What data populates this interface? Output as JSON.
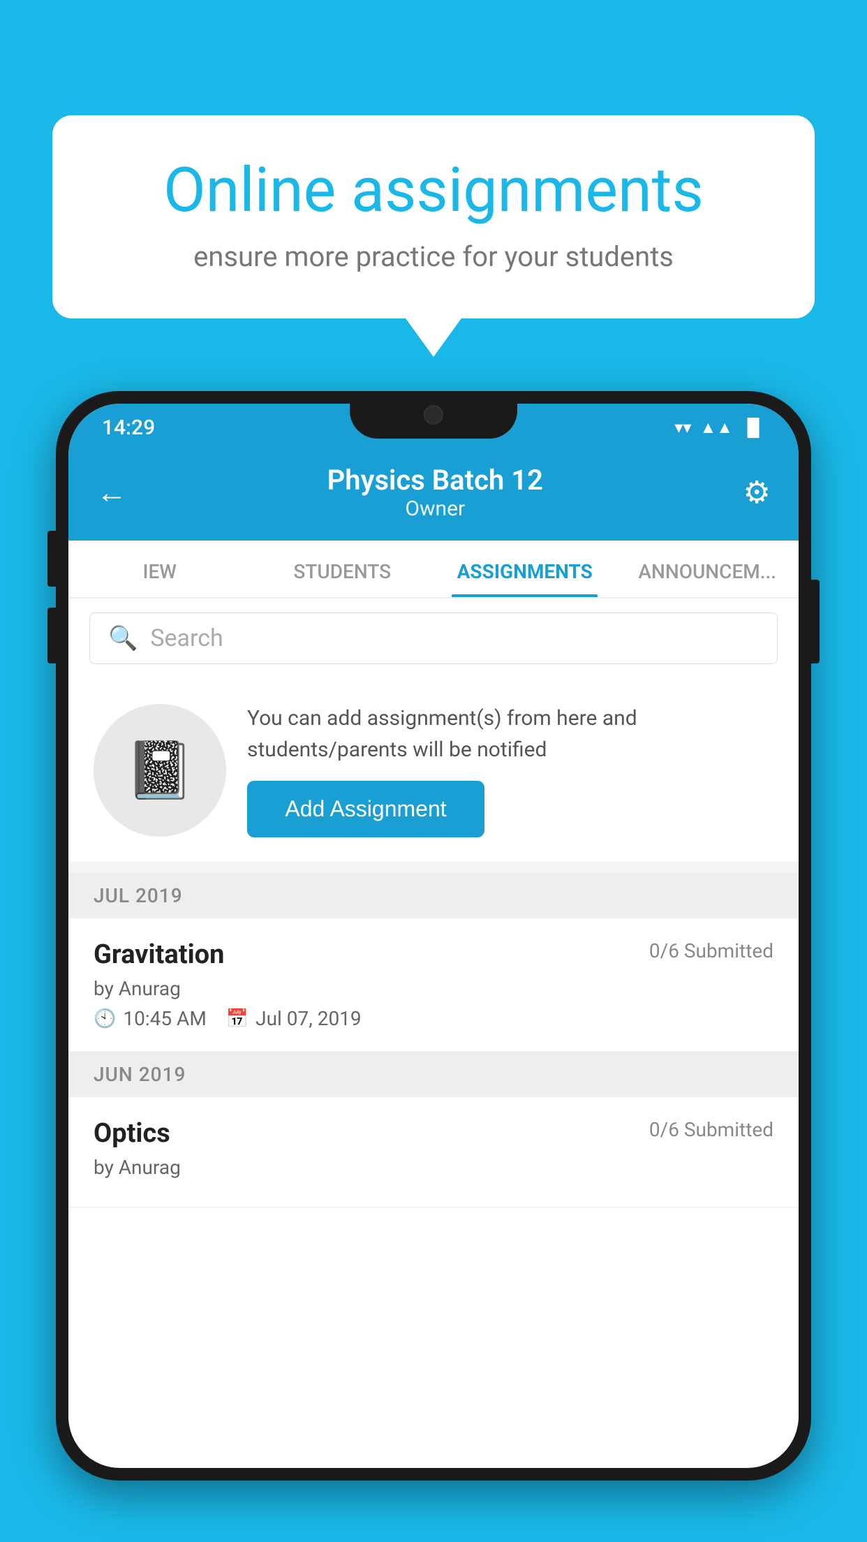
{
  "background_color": "#1ab8e8",
  "speech_bubble": {
    "title": "Online assignments",
    "subtitle": "ensure more practice for your students"
  },
  "status_bar": {
    "time": "14:29",
    "wifi": "▼",
    "signal": "▲",
    "battery": "▌"
  },
  "header": {
    "back_label": "←",
    "title": "Physics Batch 12",
    "subtitle": "Owner",
    "settings_label": "⚙"
  },
  "tabs": [
    {
      "label": "IEW",
      "active": false
    },
    {
      "label": "STUDENTS",
      "active": false
    },
    {
      "label": "ASSIGNMENTS",
      "active": true
    },
    {
      "label": "ANNOUNCEM...",
      "active": false
    }
  ],
  "search": {
    "placeholder": "Search"
  },
  "promo": {
    "text": "You can add assignment(s) from here and students/parents will be notified",
    "button_label": "Add Assignment"
  },
  "sections": [
    {
      "header": "JUL 2019",
      "assignments": [
        {
          "name": "Gravitation",
          "submitted": "0/6 Submitted",
          "by": "by Anurag",
          "time": "10:45 AM",
          "date": "Jul 07, 2019"
        }
      ]
    },
    {
      "header": "JUN 2019",
      "assignments": [
        {
          "name": "Optics",
          "submitted": "0/6 Submitted",
          "by": "by Anurag",
          "time": "",
          "date": ""
        }
      ]
    }
  ]
}
